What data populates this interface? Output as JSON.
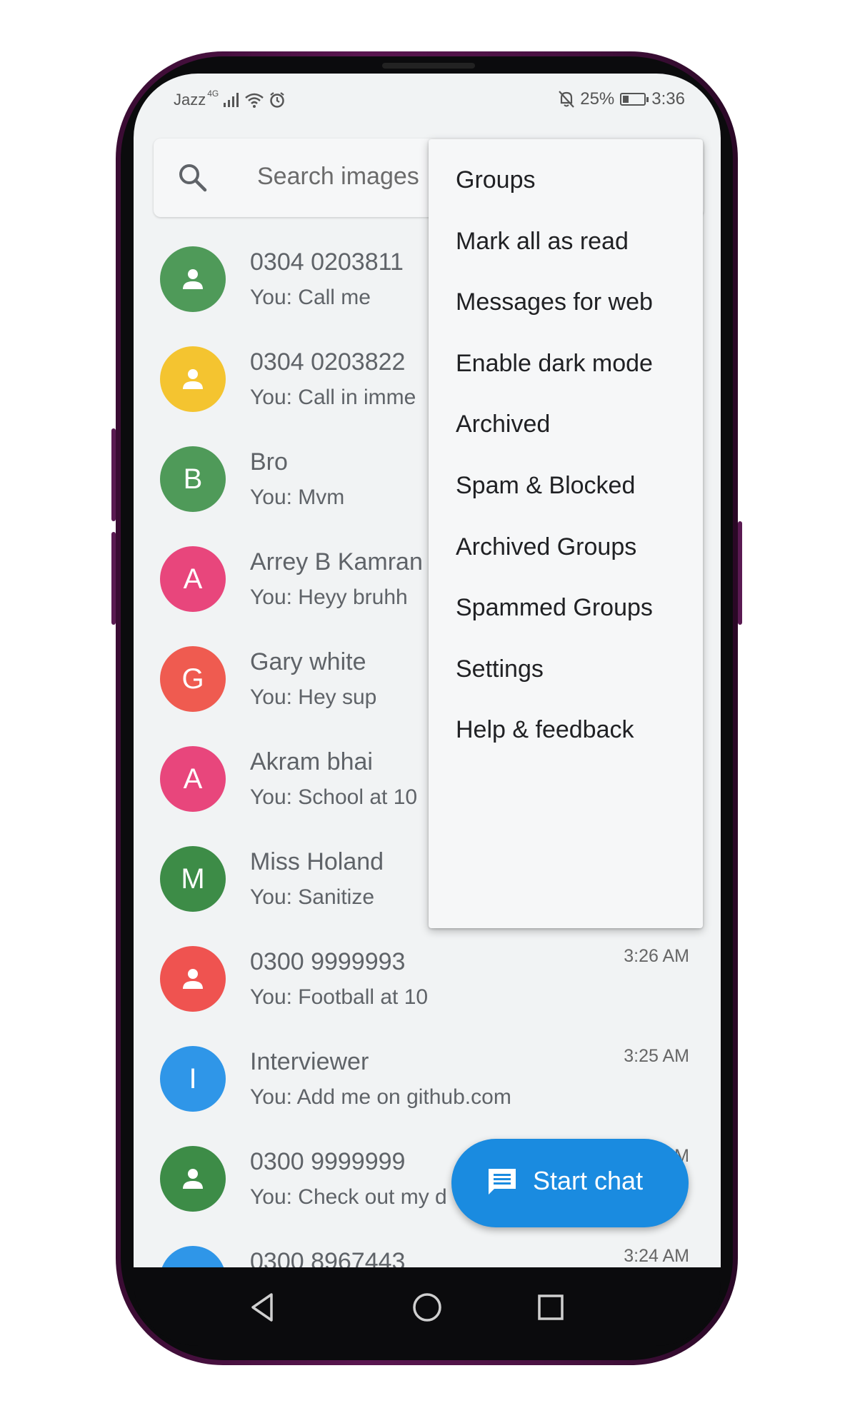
{
  "status_bar": {
    "carrier": "Jazz",
    "network": "4G",
    "battery": "25%",
    "time": "3:36",
    "battery_fraction": 0.25
  },
  "search": {
    "placeholder": "Search images"
  },
  "conversations": [
    {
      "name": "0304 0203811",
      "snippet": "You: Call me",
      "time": "",
      "avatar_type": "person-icon",
      "initial": "",
      "color": "#4f9a59"
    },
    {
      "name": "0304 0203822",
      "snippet": "You: Call in imme",
      "time": "",
      "avatar_type": "person-icon",
      "initial": "",
      "color": "#f4c430"
    },
    {
      "name": "Bro",
      "snippet": "You: Mvm",
      "time": "",
      "avatar_type": "letter",
      "initial": "B",
      "color": "#4f9a59"
    },
    {
      "name": "Arrey B Kamran",
      "snippet": "You: Heyy bruhh",
      "time": "",
      "avatar_type": "letter",
      "initial": "A",
      "color": "#e8467c"
    },
    {
      "name": "Gary white",
      "snippet": "You: Hey sup",
      "time": "",
      "avatar_type": "letter",
      "initial": "G",
      "color": "#ef5b50"
    },
    {
      "name": "Akram bhai",
      "snippet": "You: School at 10",
      "time": "",
      "avatar_type": "letter",
      "initial": "A",
      "color": "#e8467c"
    },
    {
      "name": "Miss Holand",
      "snippet": "You: Sanitize",
      "time": "",
      "avatar_type": "letter",
      "initial": "M",
      "color": "#3d8c47"
    },
    {
      "name": "0300 9999993",
      "snippet": "You: Football at 10",
      "time": "3:26 AM",
      "avatar_type": "person-icon",
      "initial": "",
      "color": "#ef5350"
    },
    {
      "name": "Interviewer",
      "snippet": "You: Add me on github.com",
      "time": "3:25 AM",
      "avatar_type": "letter",
      "initial": "I",
      "color": "#2f96e8"
    },
    {
      "name": "0300 9999999",
      "snippet": "You: Check out my d",
      "time": "M",
      "avatar_type": "person-icon",
      "initial": "",
      "color": "#3d8c47"
    },
    {
      "name": "0300 8967443",
      "snippet": "",
      "time": "3:24 AM",
      "avatar_type": "letter",
      "initial": "",
      "color": "#2f96e8"
    }
  ],
  "menu": {
    "items": [
      "Groups",
      "Mark all as read",
      "Messages for web",
      "Enable dark mode",
      "Archived",
      "Spam & Blocked",
      "Archived Groups",
      "Spammed Groups",
      "Settings",
      "Help & feedback"
    ]
  },
  "fab": {
    "label": "Start chat",
    "icon": "chat-icon",
    "color": "#1a8be0"
  },
  "nav": {
    "back": "back-icon",
    "home": "home-icon",
    "recents": "recents-icon"
  }
}
